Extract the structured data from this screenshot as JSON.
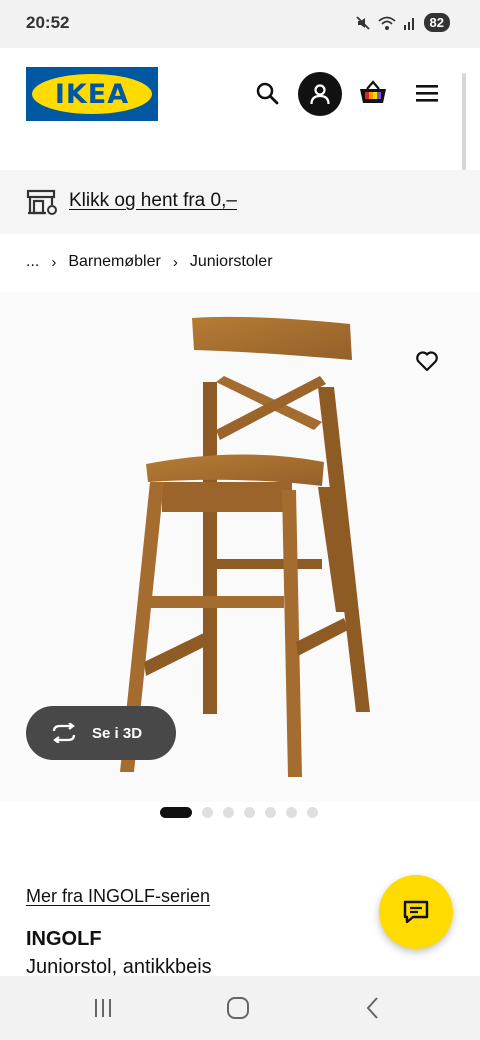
{
  "status_bar": {
    "time": "20:52",
    "battery": "82",
    "icons": [
      "mute-icon",
      "wifi-icon",
      "signal-icon",
      "battery-icon"
    ]
  },
  "header": {
    "logo_text": "IKEA",
    "icons": [
      "search-icon",
      "account-icon",
      "basket-icon",
      "menu-icon"
    ]
  },
  "pickup_banner": {
    "text": "Klikk og hent fra 0,–",
    "icon": "store-pickup-icon"
  },
  "breadcrumb": {
    "items": [
      "...",
      "Barnemøbler",
      "Juniorstoler"
    ],
    "separator": "›"
  },
  "product": {
    "view_3d_label": "Se i 3D",
    "series_link": "Mer fra INGOLF-serien",
    "name": "INGOLF",
    "description": "Juniorstol, antikkbeis"
  },
  "carousel": {
    "total": 7,
    "active": 1
  },
  "colors": {
    "ikea_blue": "#0058a3",
    "ikea_yellow": "#ffdb00",
    "wood": "#a8702e"
  }
}
